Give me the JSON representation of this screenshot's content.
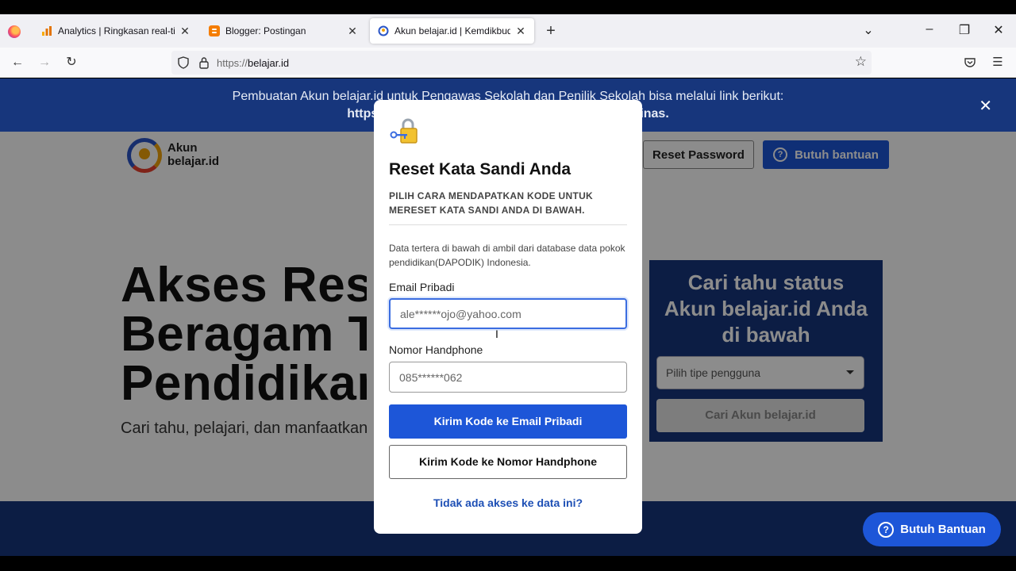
{
  "browser": {
    "tabs": [
      {
        "title": "Analytics | Ringkasan real-time",
        "active": false
      },
      {
        "title": "Blogger: Postingan",
        "active": false
      },
      {
        "title": "Akun belajar.id | Kemdikbudristek",
        "active": true
      }
    ],
    "tab_close_glyph": "✕",
    "new_tab_glyph": "+",
    "url_protocol": "https://",
    "url_host": "belajar.id"
  },
  "banner": {
    "line1": "Pembuatan Akun belajar.id untuk Pengawas Sekolah dan Penilik Sekolah bisa melalui link berikut:",
    "line2_start": "https",
    "line2_end": "inas."
  },
  "header": {
    "logo_line1": "Akun",
    "logo_line2": "belajar.id",
    "reset_password": "Reset Password",
    "help_button": "Butuh bantuan"
  },
  "hero": {
    "line1": "Akses Resı",
    "line2": "Beragam T",
    "line3": "Pendidikar",
    "subtitle": "Cari tahu, pelajari, dan manfaatkan"
  },
  "status_card": {
    "title_line1": "Cari tahu status",
    "title_line2": "Akun belajar.id Anda",
    "title_line3": "di bawah",
    "select_placeholder": "Pilih tipe pengguna",
    "search_button": "Cari Akun belajar.id"
  },
  "modal": {
    "title": "Reset Kata Sandi Anda",
    "subtitle": "PILIH CARA MENDAPATKAN KODE UNTUK MERESET KATA SANDI ANDA DI BAWAH.",
    "note": "Data tertera di bawah di ambil dari database data pokok pendidikan(DAPODIK) Indonesia.",
    "email_label": "Email Pribadi",
    "email_value": "ale******ojo@yahoo.com",
    "phone_label": "Nomor Handphone",
    "phone_value": "085******062",
    "send_email_button": "Kirim Kode ke Email Pribadi",
    "send_phone_button": "Kirim Kode ke Nomor Handphone",
    "no_access_link": "Tidak ada akses ke data ini?"
  },
  "floating_help": {
    "label": "Butuh Bantuan"
  },
  "colors": {
    "brand_navy": "#17367c",
    "primary_blue": "#1d56d8",
    "link_blue": "#1d4fb5"
  }
}
